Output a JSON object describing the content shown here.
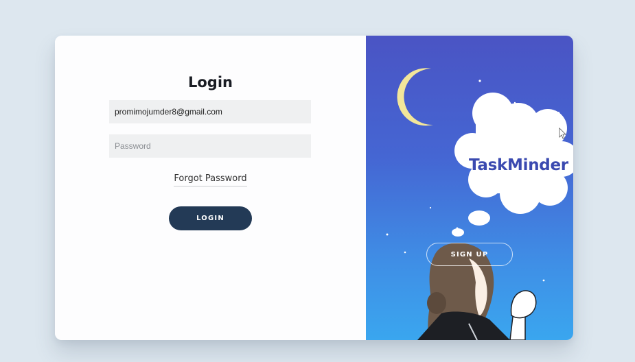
{
  "login": {
    "title": "Login",
    "email_value": "promimojumder8@gmail.com",
    "password_placeholder": "Password",
    "forgot_label": "Forgot Password",
    "login_label": "LOGIN"
  },
  "panel": {
    "brand": "TaskMinder",
    "signup_label": "SIGN UP"
  },
  "colors": {
    "button": "#233a56",
    "panel_top": "#4a54c4",
    "panel_bottom": "#3aa6ef",
    "brand": "#3b4ab0"
  },
  "icons": [
    "moon-icon",
    "thought-cloud",
    "cursor-icon"
  ]
}
